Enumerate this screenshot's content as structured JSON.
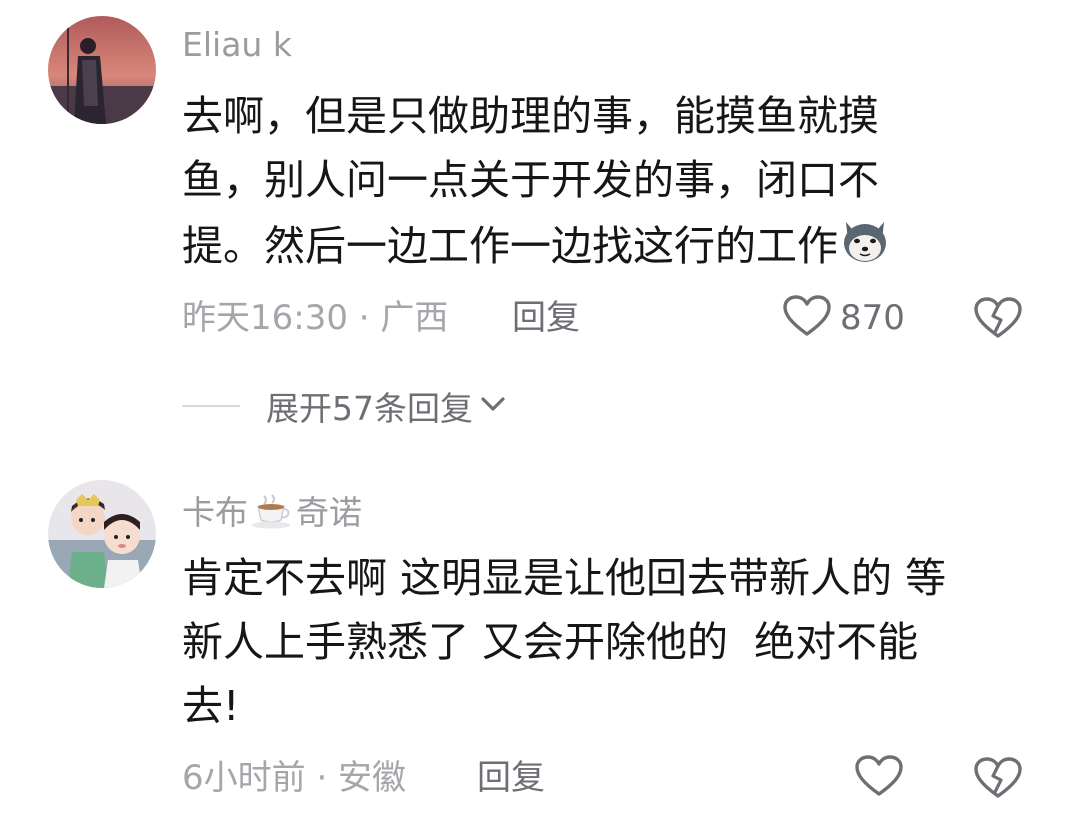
{
  "comments": [
    {
      "author": "Eliau k",
      "text": "去啊，但是只做助理的事，能摸鱼就摸\n鱼，别人问一点关于开发的事，闭口不\n提。然后一边工作一边找这行的工作",
      "emoji": "husky-dog-emoji",
      "time_location": "昨天16:30 · 广西",
      "reply_label": "回复",
      "like_count": "870",
      "expand_label": "展开57条回复"
    },
    {
      "author_prefix": "卡布",
      "author_emoji": "coffee-cup-emoji",
      "author_suffix": "奇诺",
      "text": "肯定不去啊 这明显是让他回去带新人的 等\n新人上手熟悉了 又会开除他的  绝对不能\n去!",
      "time_location": "6小时前 · 安徽",
      "reply_label": "回复"
    }
  ],
  "colors": {
    "text_primary": "#161616",
    "text_secondary": "#a5a5aa",
    "action": "#6e6e74"
  }
}
